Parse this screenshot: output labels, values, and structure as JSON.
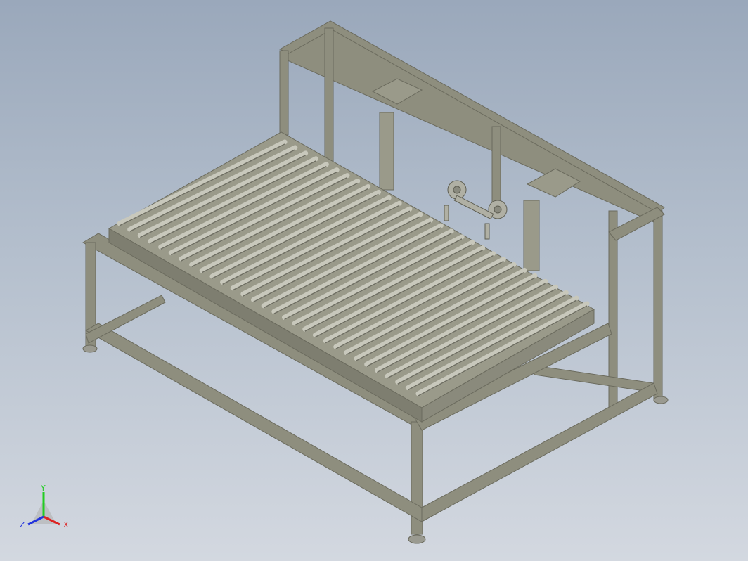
{
  "viewport": {
    "model_colors": {
      "frame": "#8e8e7e",
      "frame_shadow": "#6b6b5e",
      "frame_highlight": "#b8b8a8",
      "roller": "#c2c2b6",
      "roller_shadow": "#7a7a6e",
      "bed": "#9a9a8a",
      "foot": "#9a9a90"
    }
  },
  "triad": {
    "y_label": "Y",
    "z_label": "Z",
    "x_label": "X",
    "y_color": "#22cc22",
    "z_color": "#2233dd",
    "x_color": "#dd2222"
  }
}
